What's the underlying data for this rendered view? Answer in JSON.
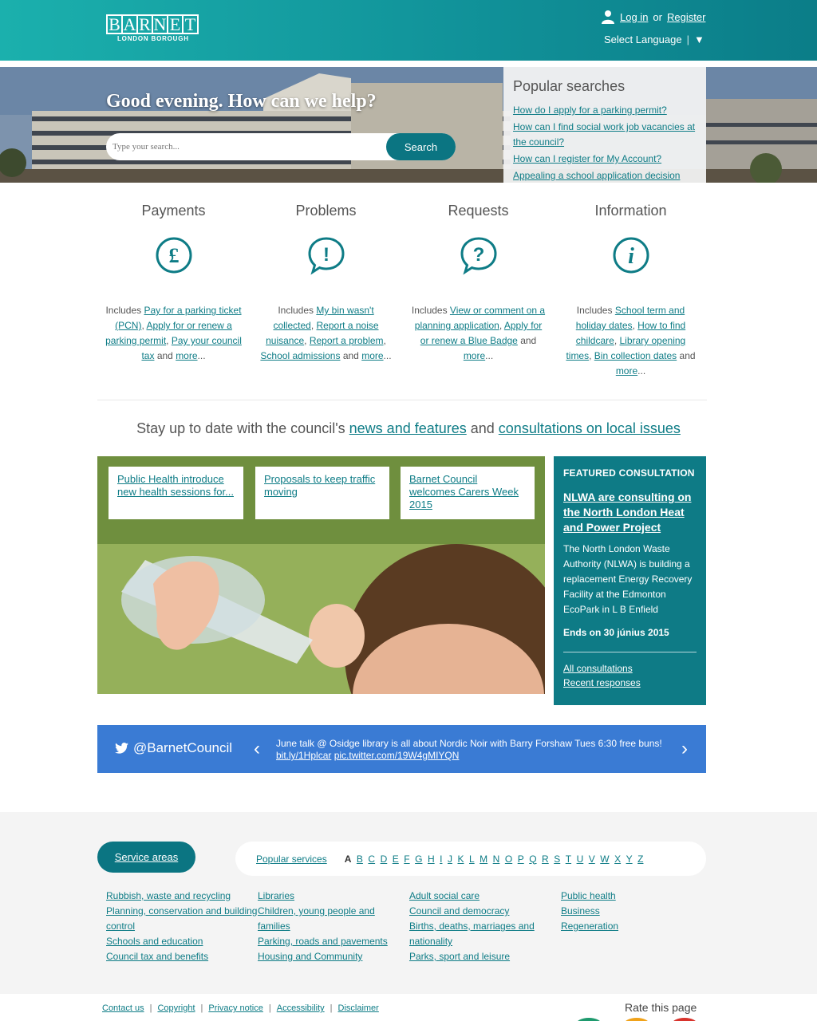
{
  "header": {
    "logo_letters": [
      "B",
      "A",
      "R",
      "N",
      "E",
      "T"
    ],
    "logo_sub": "LONDON BOROUGH",
    "login": "Log in",
    "or": "or",
    "register": "Register",
    "language": "Select Language",
    "lang_sep": "|",
    "lang_arrow": "▼"
  },
  "hero": {
    "title": "Good evening. How can we help?",
    "search_placeholder": "Type your search...",
    "search_button": "Search",
    "popular_title": "Popular searches",
    "popular": [
      "How do I apply for a parking permit?",
      "How can I find social work job vacancies at the council?",
      "How can I register for My Account?",
      "Appealing a school application decision"
    ]
  },
  "tasks": [
    {
      "title": "Payments",
      "icon": "pound-icon",
      "prefix": "Includes ",
      "links": [
        "Pay for a parking ticket (PCN)",
        "Apply for or renew a parking permit",
        "Pay your council tax"
      ],
      "and": "and",
      "more": "more",
      "ellipsis": "..."
    },
    {
      "title": "Problems",
      "icon": "exclamation-icon",
      "prefix": "Includes ",
      "links": [
        "My bin wasn't collected",
        "Report a noise nuisance",
        "Report a problem",
        "School admissions"
      ],
      "and": "and",
      "more": "more",
      "ellipsis": "..."
    },
    {
      "title": "Requests",
      "icon": "question-icon",
      "prefix": "Includes ",
      "links": [
        "View or comment on a planning application",
        "Apply for or renew a Blue Badge"
      ],
      "and": "and",
      "more": "more",
      "ellipsis": "..."
    },
    {
      "title": "Information",
      "icon": "info-icon",
      "prefix": "Includes ",
      "links": [
        "School term and holiday dates",
        "How to find childcare",
        "Library opening times",
        "Bin collection dates"
      ],
      "and": "and",
      "more": "more",
      "ellipsis": "..."
    }
  ],
  "stay": {
    "prefix": "Stay up to date with the council's ",
    "news_link": "news and features",
    "middle": " and ",
    "consult_link": "consultations on local issues"
  },
  "news_cards": [
    "Public Health introduce new health sessions for...",
    "Proposals to keep traffic moving",
    "Barnet Council welcomes Carers Week 2015"
  ],
  "consultation": {
    "heading": "FEATURED CONSULTATION",
    "title": "NLWA are consulting on the North London Heat and Power Project",
    "body": "The North London Waste Authority (NLWA) is building a replacement Energy Recovery Facility at the Edmonton EcoPark in L B Enfield",
    "ends": "Ends on 30 június 2015",
    "all": "All consultations",
    "recent": "Recent responses"
  },
  "twitter": {
    "handle": "@BarnetCouncil",
    "tweet": "June talk @ Osidge library is all about Nordic Noir with Barry Forshaw Tues 6:30 free buns!",
    "link1": "bit.ly/1Hplcar",
    "link2": "pic.twitter.com/19W4gMIYQN",
    "prev": "‹",
    "next": "›"
  },
  "services": {
    "button": "Service areas",
    "popular": "Popular services",
    "letters": [
      "A",
      "B",
      "C",
      "D",
      "E",
      "F",
      "G",
      "H",
      "I",
      "J",
      "K",
      "L",
      "M",
      "N",
      "O",
      "P",
      "Q",
      "R",
      "S",
      "T",
      "U",
      "V",
      "W",
      "X",
      "Y",
      "Z"
    ],
    "columns": [
      [
        "Rubbish, waste and recycling",
        "Planning, conservation and building control",
        "Schools and education",
        "Council tax and benefits"
      ],
      [
        "Libraries",
        "Children, young people and families",
        "Parking, roads and pavements",
        "Housing and Community"
      ],
      [
        "Adult social care",
        "Council and democracy",
        "Births, deaths, marriages and nationality",
        "Parks, sport and leisure"
      ],
      [
        "Public health",
        "Business",
        "Regeneration"
      ]
    ]
  },
  "footer": {
    "links": [
      "Contact us",
      "Copyright",
      "Privacy notice",
      "Accessibility",
      "Disclaimer"
    ],
    "sep": "|",
    "rate": "Rate this page"
  },
  "colors": {
    "teal": "#0e7c86",
    "header_start": "#1bb0ad",
    "twitter_blue": "#3a7bd4"
  }
}
